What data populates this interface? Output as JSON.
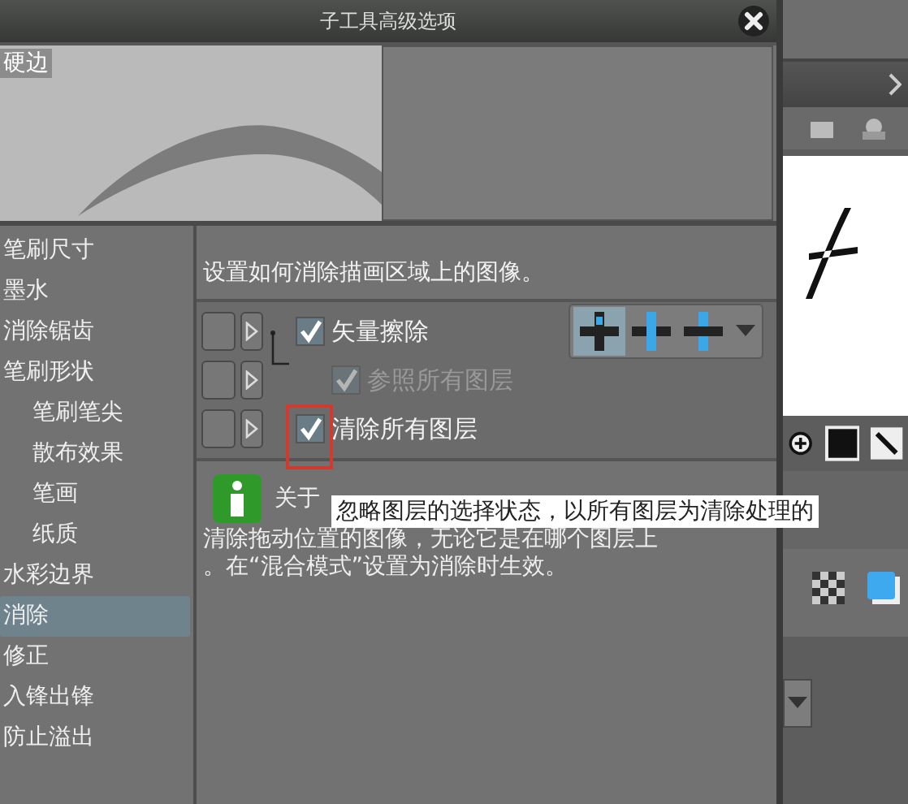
{
  "window": {
    "title": "子工具高级选项"
  },
  "preview": {
    "label": "硬边"
  },
  "sidebar": {
    "items": [
      {
        "label": "笔刷尺寸",
        "selected": false
      },
      {
        "label": "墨水",
        "selected": false
      },
      {
        "label": "消除锯齿",
        "selected": false
      },
      {
        "label": "笔刷形状",
        "selected": false,
        "children": [
          {
            "label": "笔刷笔尖",
            "selected": false
          },
          {
            "label": "散布效果",
            "selected": false
          },
          {
            "label": "笔画",
            "selected": false
          },
          {
            "label": "纸质",
            "selected": false
          }
        ]
      },
      {
        "label": "水彩边界",
        "selected": false
      },
      {
        "label": "消除",
        "selected": true
      },
      {
        "label": "修正",
        "selected": false
      },
      {
        "label": "入锋出锋",
        "selected": false
      },
      {
        "label": "防止溢出",
        "selected": false
      }
    ]
  },
  "description": "设置如何消除描画区域上的图像。",
  "options": [
    {
      "label": "矢量擦除",
      "checked": true,
      "disabled": false,
      "modes": [
        {
          "selected": true
        },
        {
          "selected": false
        },
        {
          "selected": false
        }
      ],
      "children": [
        {
          "label": "参照所有图层",
          "checked": true,
          "disabled": true
        }
      ]
    },
    {
      "label": "清除所有图层",
      "checked": true,
      "disabled": false,
      "highlighted": true
    }
  ],
  "info": {
    "title": "关于",
    "lines": [
      "清除拖动位置的图像，无论它是在哪个图层上",
      "。在“混合模式”设置为消除时生效。"
    ]
  },
  "tooltip": "忽略图层的选择状态，以所有图层为清除处理的"
}
